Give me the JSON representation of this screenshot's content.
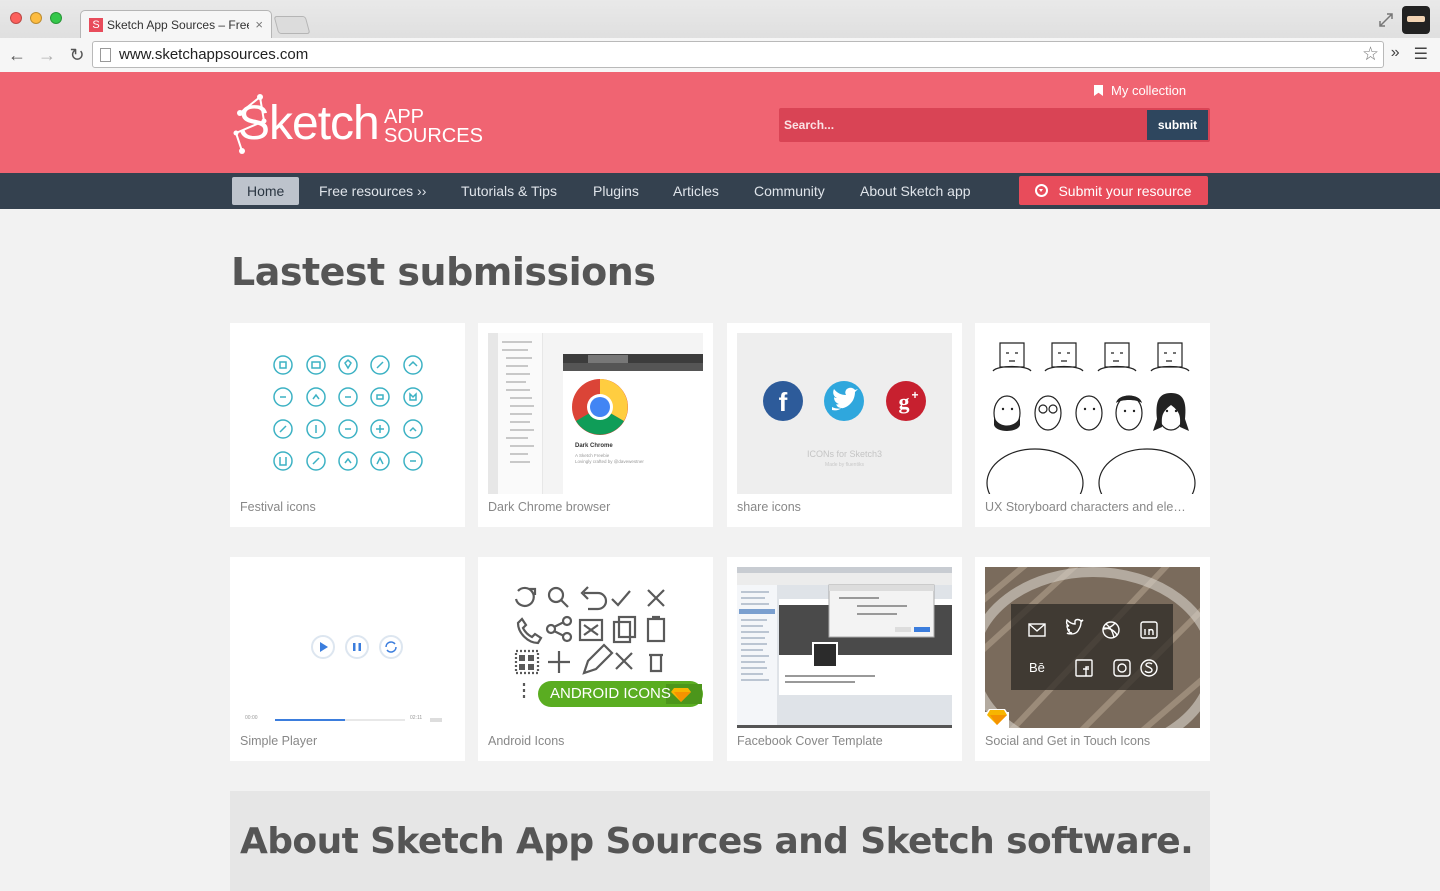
{
  "browser": {
    "tab_title": "Sketch App Sources – Free",
    "tab_close": "×",
    "favicon": "S",
    "url": "www.sketchappsources.com"
  },
  "header": {
    "logo_main": "Sketch",
    "logo_app": "APP",
    "logo_sources": "SOURCES",
    "collection_label": "My collection",
    "search_placeholder": "Search...",
    "submit_label": "submit"
  },
  "nav": {
    "items": [
      {
        "label": "Home",
        "active": true
      },
      {
        "label": "Free resources ››",
        "active": false
      },
      {
        "label": "Tutorials & Tips",
        "active": false
      },
      {
        "label": "Plugins",
        "active": false
      },
      {
        "label": "Articles",
        "active": false
      },
      {
        "label": "Community",
        "active": false
      },
      {
        "label": "About Sketch app",
        "active": false
      }
    ],
    "submit_resource": "Submit your resource"
  },
  "main": {
    "heading": "Lastest submissions",
    "cards": [
      {
        "title": "Festival icons"
      },
      {
        "title": "Dark Chrome browser",
        "thumb_title": "Dark Chrome",
        "thumb_sub1": "A Sketch Freebie",
        "thumb_sub2": "Lovingly crafted by @davewestner"
      },
      {
        "title": "share icons",
        "thumb_caption": "ICONs for Sketch3",
        "thumb_sub": "Made by fluentiks"
      },
      {
        "title": "UX Storyboard characters and ele…"
      },
      {
        "title": "Simple Player",
        "time_start": "00:00",
        "time_end": "02:11"
      },
      {
        "title": "Android Icons",
        "banner": "ANDROID ICONS"
      },
      {
        "title": "Facebook Cover Template"
      },
      {
        "title": "Social and Get in Touch Icons",
        "icons_row2_text": "Bē"
      }
    ],
    "about_title": "About Sketch App Sources and Sketch software."
  },
  "colors": {
    "brand": "#f06472",
    "nav": "#34414f",
    "accent": "#e84c5b",
    "icon_teal": "#3db2c4"
  }
}
